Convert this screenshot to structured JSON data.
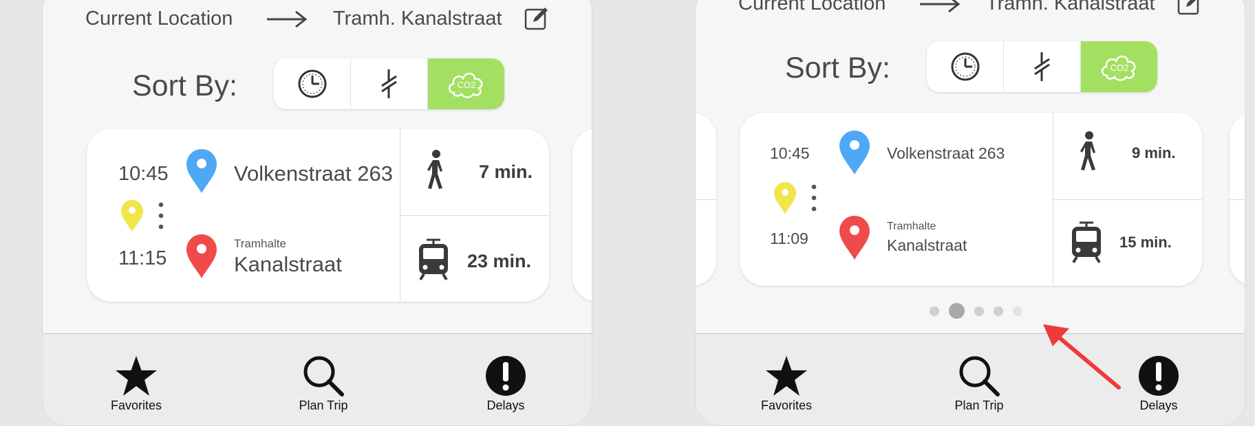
{
  "screens": [
    {
      "route": {
        "from": "Current Location",
        "to": "Tramh. Kanalstraat"
      },
      "sort": {
        "label": "Sort By:",
        "options": [
          "time-icon",
          "transfers-icon",
          "co2-icon"
        ],
        "active": "co2-icon",
        "co2_text": "CO2"
      },
      "trip": {
        "departure_time": "10:45",
        "departure_place": "Volkenstraat 263",
        "arrival_time": "11:15",
        "arrival_type": "Tramhalte",
        "arrival_place": "Kanalstraat",
        "walk_duration": "7 min.",
        "tram_duration": "23 min."
      },
      "tabs": [
        {
          "label": "Favorites",
          "icon": "star-icon"
        },
        {
          "label": "Plan Trip",
          "icon": "search-icon"
        },
        {
          "label": "Delays",
          "icon": "alert-icon"
        }
      ]
    },
    {
      "route": {
        "from": "Current Location",
        "to": "Tramh. Kanalstraat"
      },
      "sort": {
        "label": "Sort By:",
        "options": [
          "time-icon",
          "transfers-icon",
          "co2-icon"
        ],
        "active": "co2-icon",
        "co2_text": "CO2"
      },
      "trip": {
        "departure_time": "10:45",
        "departure_place": "Volkenstraat 263",
        "arrival_time": "11:09",
        "arrival_type": "Tramhalte",
        "arrival_place": "Kanalstraat",
        "walk_duration": "9 min.",
        "tram_duration": "15 min."
      },
      "pager": {
        "count": 5,
        "active_index": 1
      },
      "tabs": [
        {
          "label": "Favorites",
          "icon": "star-icon"
        },
        {
          "label": "Plan Trip",
          "icon": "search-icon"
        },
        {
          "label": "Delays",
          "icon": "alert-icon"
        }
      ]
    }
  ],
  "colors": {
    "active_sort": "#a3e062",
    "pin_departure": "#4ea8f5",
    "pin_arrival": "#ef4b4b",
    "pin_transfer": "#f0e64a",
    "annotation_arrow": "#f03a3a"
  }
}
